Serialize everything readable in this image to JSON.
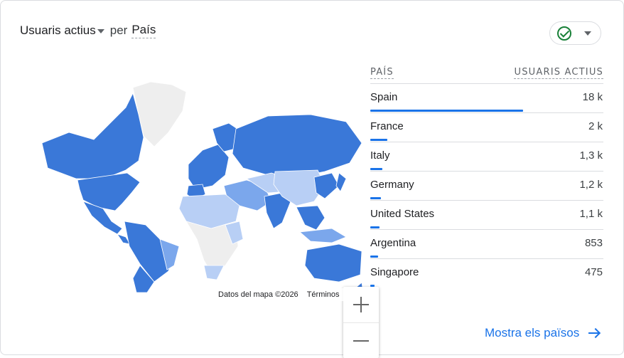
{
  "header": {
    "metric_label": "Usuaris actius",
    "per_label": "per",
    "dimension_label": "País"
  },
  "status": {
    "icon": "check-circle-icon",
    "color": "#188038"
  },
  "map": {
    "attribution": "Datos del mapa ©2026",
    "terms_label": "Términos",
    "zoom_in_icon": "plus-icon",
    "zoom_out_icon": "minus-icon",
    "colors": {
      "high": "#3a78d8",
      "mid": "#7ba7ec",
      "low": "#b8cff5",
      "none": "#eeeeee"
    }
  },
  "table": {
    "col_country": "PAÍS",
    "col_users": "USUARIS ACTIUS",
    "rows": [
      {
        "country": "Spain",
        "value": "18 k",
        "share": 1.0
      },
      {
        "country": "France",
        "value": "2 k",
        "share": 0.11
      },
      {
        "country": "Italy",
        "value": "1,3 k",
        "share": 0.08
      },
      {
        "country": "Germany",
        "value": "1,2 k",
        "share": 0.07
      },
      {
        "country": "United States",
        "value": "1,1 k",
        "share": 0.06
      },
      {
        "country": "Argentina",
        "value": "853",
        "share": 0.05
      },
      {
        "country": "Singapore",
        "value": "475",
        "share": 0.03
      }
    ]
  },
  "footer": {
    "link_label": "Mostra els països",
    "arrow_icon": "arrow-right-icon"
  }
}
